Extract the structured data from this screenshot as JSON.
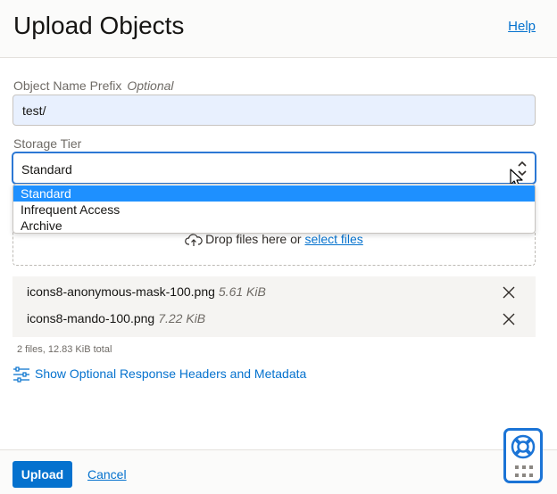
{
  "header": {
    "title": "Upload Objects",
    "help_label": "Help"
  },
  "prefix": {
    "label": "Object Name Prefix",
    "optional_label": "Optional",
    "value": "test/"
  },
  "storage_tier": {
    "label": "Storage Tier",
    "selected": "Standard",
    "options": [
      "Standard",
      "Infrequent Access",
      "Archive"
    ]
  },
  "dropzone": {
    "text": "Drop files here or",
    "link_label": "select files"
  },
  "files": [
    {
      "name": "icons8-anonymous-mask-100.png",
      "size": "5.61 KiB"
    },
    {
      "name": "icons8-mando-100.png",
      "size": "7.22 KiB"
    }
  ],
  "summary": "2 files, 12.83 KiB total",
  "optional_headers_label": "Show Optional Response Headers and Metadata",
  "footer": {
    "upload_label": "Upload",
    "cancel_label": "Cancel"
  },
  "colors": {
    "accent": "#0572ce",
    "selected_option": "#1e90ff",
    "help_widget_border": "#1b74d6"
  }
}
